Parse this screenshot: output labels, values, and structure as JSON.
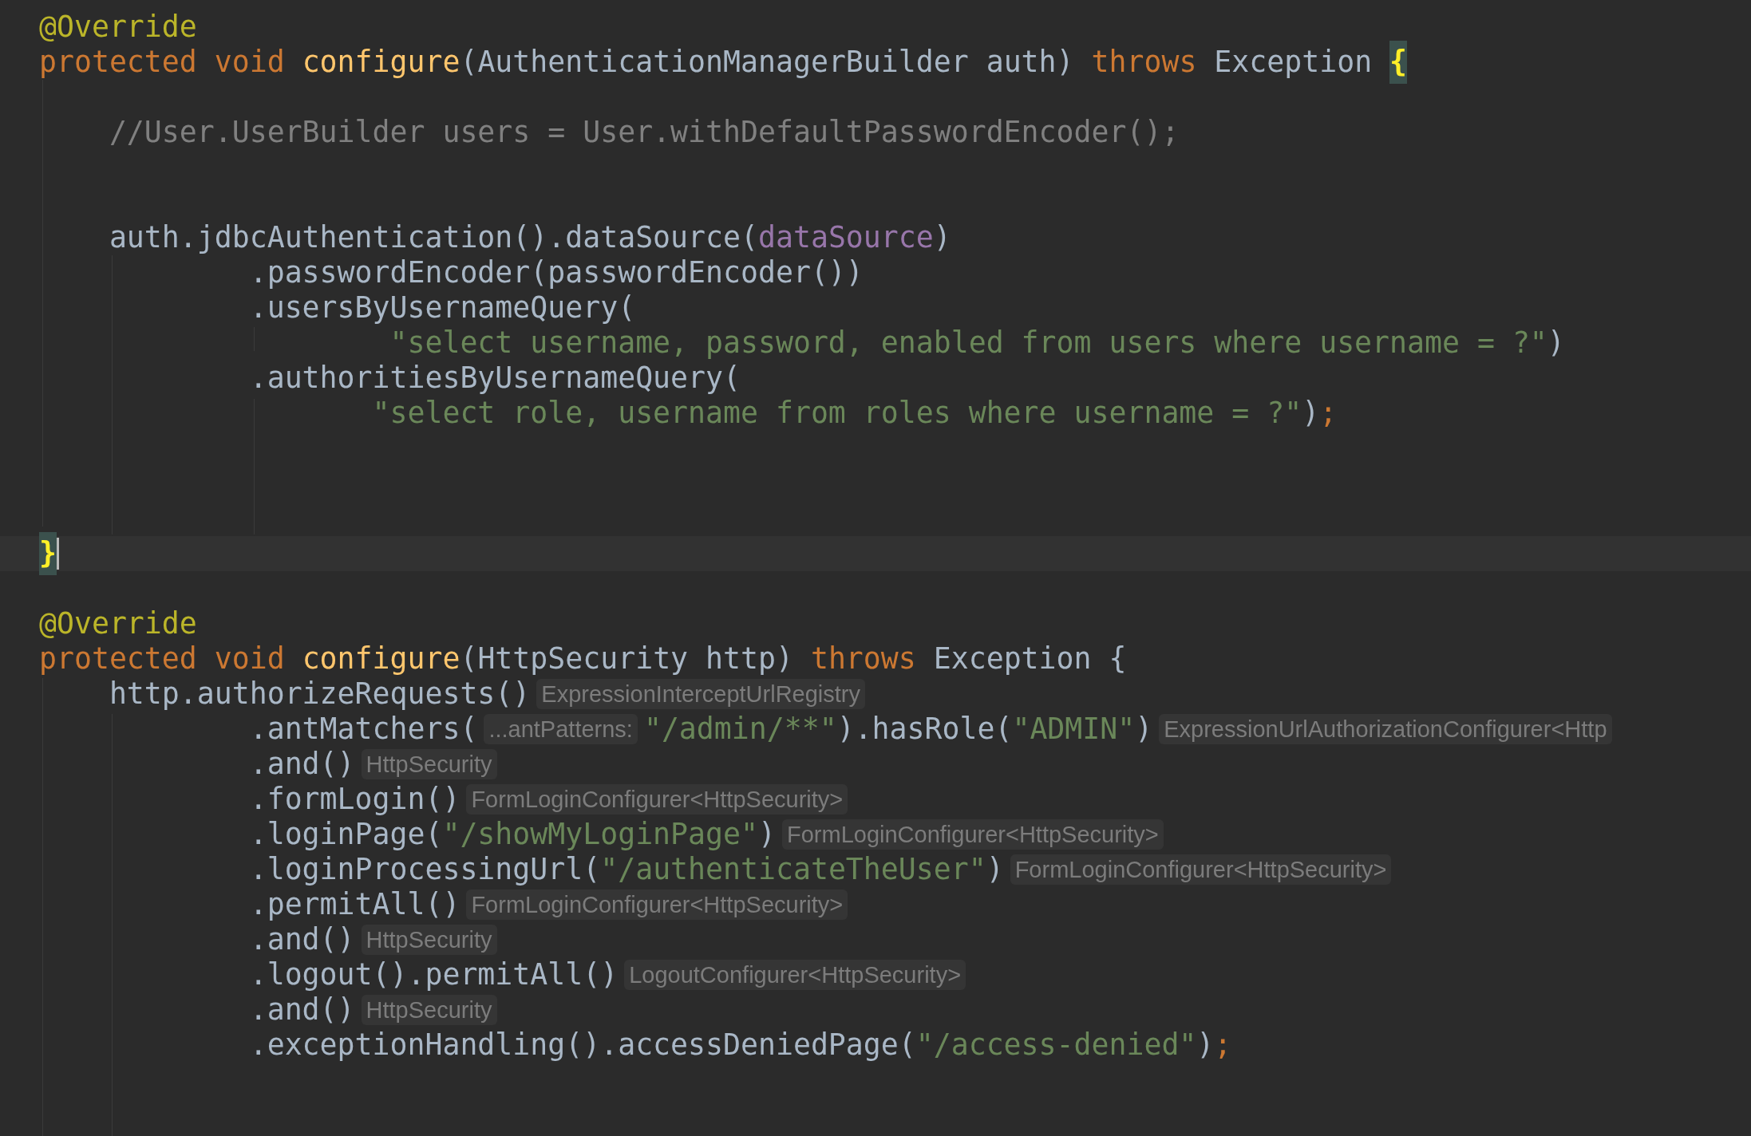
{
  "editor": {
    "lines": [
      {
        "current": false,
        "tokens": [
          {
            "kind": "annotation",
            "text": "@Override"
          }
        ]
      },
      {
        "current": false,
        "tokens": [
          {
            "kind": "keyword",
            "text": "protected void "
          },
          {
            "kind": "method",
            "text": "configure"
          },
          {
            "kind": "plain",
            "text": "(AuthenticationManagerBuilder auth) "
          },
          {
            "kind": "keyword",
            "text": "throws "
          },
          {
            "kind": "plain",
            "text": "Exception "
          },
          {
            "kind": "brace_match",
            "text": "{"
          }
        ]
      },
      {
        "current": false
      },
      {
        "current": false,
        "tokens": [
          {
            "kind": "comment",
            "text": "    //User.UserBuilder users = User.withDefaultPasswordEncoder();"
          }
        ]
      },
      {
        "current": false
      },
      {
        "current": false
      },
      {
        "current": false,
        "tokens": [
          {
            "kind": "plain",
            "text": "    auth.jdbcAuthentication().dataSource("
          },
          {
            "kind": "field",
            "text": "dataSource"
          },
          {
            "kind": "plain",
            "text": ")"
          }
        ]
      },
      {
        "current": false,
        "tokens": [
          {
            "kind": "plain",
            "text": "            .passwordEncoder(passwordEncoder())"
          }
        ]
      },
      {
        "current": false,
        "tokens": [
          {
            "kind": "plain",
            "text": "            .usersByUsernameQuery("
          }
        ]
      },
      {
        "current": false,
        "tokens": [
          {
            "kind": "string",
            "text": "                    \"select username, password, enabled from users where username = ?\""
          },
          {
            "kind": "plain",
            "text": ")"
          }
        ]
      },
      {
        "current": false,
        "tokens": [
          {
            "kind": "plain",
            "text": "            .authoritiesByUsernameQuery("
          }
        ]
      },
      {
        "current": false,
        "tokens": [
          {
            "kind": "string",
            "text": "                   \"select role, username from roles where username = ?\""
          },
          {
            "kind": "plain",
            "text": ")"
          },
          {
            "kind": "keyword",
            "text": ";"
          }
        ]
      },
      {
        "current": false
      },
      {
        "current": false
      },
      {
        "current": false
      },
      {
        "current": true,
        "tokens": [
          {
            "kind": "brace_match",
            "text": "}"
          }
        ]
      },
      {
        "current": false
      },
      {
        "current": false,
        "tokens": [
          {
            "kind": "annotation",
            "text": "@Override"
          }
        ]
      },
      {
        "current": false,
        "tokens": [
          {
            "kind": "keyword",
            "text": "protected void "
          },
          {
            "kind": "method",
            "text": "configure"
          },
          {
            "kind": "plain",
            "text": "(HttpSecurity http) "
          },
          {
            "kind": "keyword",
            "text": "throws "
          },
          {
            "kind": "plain",
            "text": "Exception {"
          }
        ]
      },
      {
        "current": false,
        "tokens": [
          {
            "kind": "plain",
            "text": "    http.authorizeRequests()"
          },
          {
            "kind": "hint",
            "text": "ExpressionInterceptUrlRegistry"
          }
        ]
      },
      {
        "current": false,
        "tokens": [
          {
            "kind": "plain",
            "text": "            .antMatchers("
          },
          {
            "kind": "hint",
            "text": "...antPatterns:"
          },
          {
            "kind": "string",
            "text": "\"/admin/**\""
          },
          {
            "kind": "plain",
            "text": ").hasRole("
          },
          {
            "kind": "string",
            "text": "\"ADMIN\""
          },
          {
            "kind": "plain",
            "text": ")"
          },
          {
            "kind": "hint",
            "text": "ExpressionUrlAuthorizationConfigurer<Http"
          }
        ]
      },
      {
        "current": false,
        "tokens": [
          {
            "kind": "plain",
            "text": "            .and()"
          },
          {
            "kind": "hint",
            "text": "HttpSecurity"
          }
        ]
      },
      {
        "current": false,
        "tokens": [
          {
            "kind": "plain",
            "text": "            .formLogin()"
          },
          {
            "kind": "hint",
            "text": "FormLoginConfigurer<HttpSecurity>"
          }
        ]
      },
      {
        "current": false,
        "tokens": [
          {
            "kind": "plain",
            "text": "            .loginPage("
          },
          {
            "kind": "string",
            "text": "\"/showMyLoginPage\""
          },
          {
            "kind": "plain",
            "text": ")"
          },
          {
            "kind": "hint",
            "text": "FormLoginConfigurer<HttpSecurity>"
          }
        ]
      },
      {
        "current": false,
        "tokens": [
          {
            "kind": "plain",
            "text": "            .loginProcessingUrl("
          },
          {
            "kind": "string",
            "text": "\"/authenticateTheUser\""
          },
          {
            "kind": "plain",
            "text": ")"
          },
          {
            "kind": "hint",
            "text": "FormLoginConfigurer<HttpSecurity>"
          }
        ]
      },
      {
        "current": false,
        "tokens": [
          {
            "kind": "plain",
            "text": "            .permitAll()"
          },
          {
            "kind": "hint",
            "text": "FormLoginConfigurer<HttpSecurity>"
          }
        ]
      },
      {
        "current": false,
        "tokens": [
          {
            "kind": "plain",
            "text": "            .and()"
          },
          {
            "kind": "hint",
            "text": "HttpSecurity"
          }
        ]
      },
      {
        "current": false,
        "tokens": [
          {
            "kind": "plain",
            "text": "            .logout().permitAll()"
          },
          {
            "kind": "hint",
            "text": "LogoutConfigurer<HttpSecurity>"
          }
        ]
      },
      {
        "current": false,
        "tokens": [
          {
            "kind": "plain",
            "text": "            .and()"
          },
          {
            "kind": "hint",
            "text": "HttpSecurity"
          }
        ]
      },
      {
        "current": false,
        "tokens": [
          {
            "kind": "plain",
            "text": "            .exceptionHandling().accessDeniedPage("
          },
          {
            "kind": "string",
            "text": "\"/access-denied\""
          },
          {
            "kind": "plain",
            "text": ")"
          },
          {
            "kind": "keyword",
            "text": ";"
          }
        ]
      },
      {
        "current": false
      },
      {
        "current": false
      }
    ]
  }
}
